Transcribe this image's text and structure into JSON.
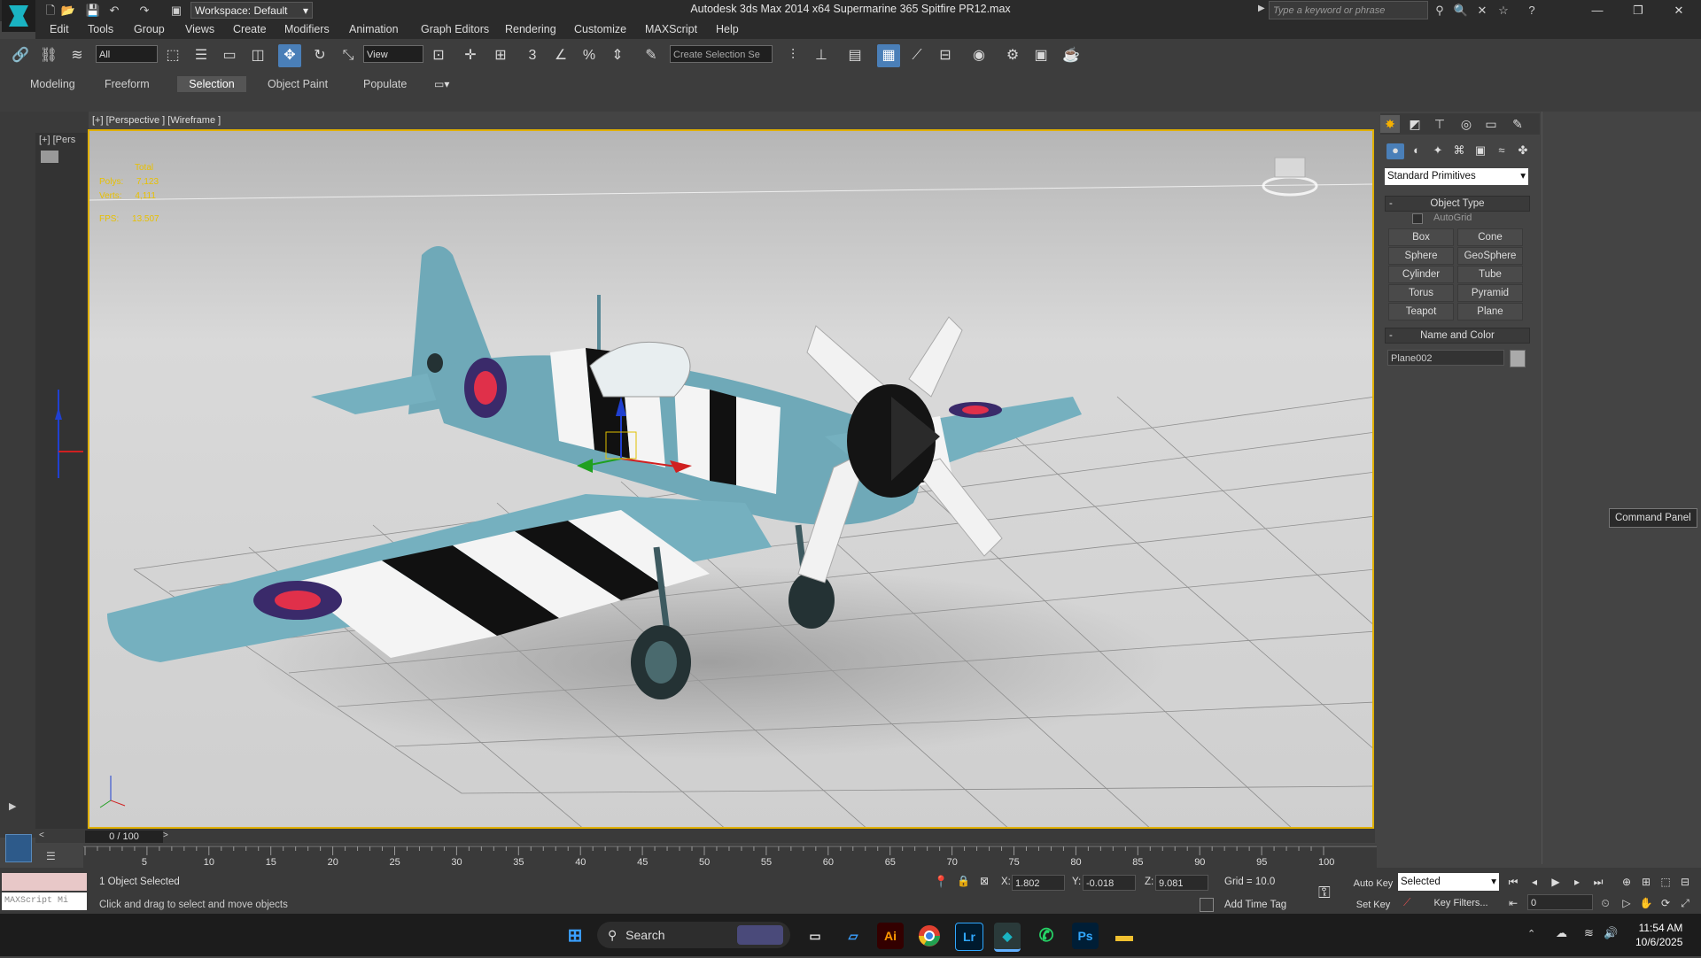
{
  "titlebar": {
    "workspace": "Workspace: Default",
    "title": "Autodesk 3ds Max  2014 x64     Supermarine 365 Spitfire PR12.max",
    "search_placeholder": "Type a keyword or phrase",
    "quick_access_icons": [
      "new-icon",
      "open-icon",
      "save-icon",
      "undo-icon",
      "redo-icon",
      "project-folder-icon"
    ],
    "help_icons": [
      "binoculars-icon",
      "search-icon",
      "exchange-icon",
      "star-icon",
      "help-icon"
    ]
  },
  "menu": [
    "Edit",
    "Tools",
    "Group",
    "Views",
    "Create",
    "Modifiers",
    "Animation",
    "Graph Editors",
    "Rendering",
    "Customize",
    "MAXScript",
    "Help"
  ],
  "toolbar": {
    "filter": "All",
    "refcoord": "View",
    "selection_set_placeholder": "Create Selection Se",
    "snap_label": "3"
  },
  "ribbon_tabs": [
    "Modeling",
    "Freeform",
    "Selection",
    "Object Paint",
    "Populate"
  ],
  "ribbon_active": "Selection",
  "viewport": {
    "label": "[+] [Perspective ] [Wireframe ]",
    "stats_header": "Total",
    "stats_polys_label": "Polys:",
    "stats_polys": "7,123",
    "stats_verts_label": "Verts:",
    "stats_verts": "4,111",
    "stats_fps_label": "FPS:",
    "stats_fps": "13.507"
  },
  "side_viewport_label": "[+] [Pers",
  "command_panel": {
    "tabs": [
      "create-icon",
      "modify-icon",
      "hierarchy-icon",
      "motion-icon",
      "display-icon",
      "utilities-icon"
    ],
    "active_tab": 0,
    "category_icons": [
      "geometry-icon",
      "shapes-icon",
      "lights-icon",
      "cameras-icon",
      "helpers-icon",
      "spacewarps-icon",
      "systems-icon"
    ],
    "primitive_type": "Standard Primitives",
    "object_type_title": "Object Type",
    "autogrid": "AutoGrid",
    "buttons": [
      "Box",
      "Cone",
      "Sphere",
      "GeoSphere",
      "Cylinder",
      "Tube",
      "Torus",
      "Pyramid",
      "Teapot",
      "Plane"
    ],
    "name_color_title": "Name and Color",
    "object_name": "Plane002",
    "swatch_color": "#aaaaaa",
    "tooltip": "Command Panel"
  },
  "timeline": {
    "slider": "0 / 100",
    "ticks": [
      "5",
      "10",
      "15",
      "20",
      "25",
      "30",
      "35",
      "40",
      "45",
      "50",
      "55",
      "60",
      "65",
      "70",
      "75",
      "80",
      "85",
      "90",
      "95",
      "100"
    ]
  },
  "status": {
    "maxscript": "MAXScript Mi",
    "selection_info": "1 Object Selected",
    "prompt": "Click and drag to select and move objects",
    "x_label": "X:",
    "x": "1.802",
    "y_label": "Y:",
    "y": "-0.018",
    "z_label": "Z:",
    "z": "9.081",
    "grid": "Grid = 10.0",
    "add_time_tag": "Add Time Tag",
    "auto_key": "Auto Key",
    "set_key": "Set Key",
    "selected": "Selected",
    "key_filters": "Key Filters...",
    "frame": "0"
  },
  "taskbar": {
    "search": "Search",
    "apps": [
      "start-icon",
      "search-icon",
      "widgets-icon",
      "files-icon",
      "explorer-icon",
      "illustrator-icon",
      "chrome-icon",
      "lightroom-icon",
      "3dsmax-icon",
      "whatsapp-icon",
      "photoshop-icon",
      "folder-icon"
    ],
    "illustrator": "Ai",
    "lightroom": "Lr",
    "photoshop": "Ps",
    "time": "11:54 AM",
    "date": "10/6/2025"
  },
  "colors": {
    "accent": "#4a7fb8",
    "viewport_border": "#e0b000",
    "plane_body": "#6fa9b8",
    "roundel_red": "#e0304a",
    "roundel_blue": "#3a2a6a",
    "gizmo_x": "#d02020",
    "gizmo_y": "#20a020",
    "gizmo_z": "#2040d0"
  }
}
